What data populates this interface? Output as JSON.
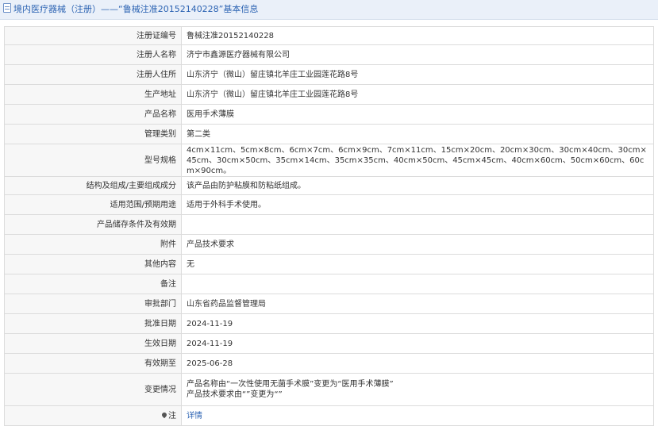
{
  "header": {
    "breadcrumb_root": "境内医疗器械（注册）",
    "separator": "——",
    "page_title": "“鲁械注准20152140228”基本信息"
  },
  "rows": [
    {
      "label": "注册证编号",
      "value": "鲁械注准20152140228"
    },
    {
      "label": "注册人名称",
      "value": "济宁市鑫源医疗器械有限公司"
    },
    {
      "label": "注册人住所",
      "value": "山东济宁（微山）留庄镇北羊庄工业园莲花路8号"
    },
    {
      "label": "生产地址",
      "value": "山东济宁（微山）留庄镇北羊庄工业园莲花路8号"
    },
    {
      "label": "产品名称",
      "value": "医用手术薄膜"
    },
    {
      "label": "管理类别",
      "value": "第二类"
    },
    {
      "label": "型号规格",
      "value": "4cm×11cm、5cm×8cm、6cm×7cm、6cm×9cm、7cm×11cm、15cm×20cm、20cm×30cm、30cm×40cm、30cm×45cm、30cm×50cm、35cm×14cm、35cm×35cm、40cm×50cm、45cm×45cm、40cm×60cm、50cm×60cm、60cm×90cm。"
    },
    {
      "label": "结构及组成/主要组成成分",
      "value": "该产品由防护粘膜和防粘纸组成。"
    },
    {
      "label": "适用范围/预期用途",
      "value": "适用于外科手术使用。"
    },
    {
      "label": "产品储存条件及有效期",
      "value": ""
    },
    {
      "label": "附件",
      "value": "产品技术要求"
    },
    {
      "label": "其他内容",
      "value": "无"
    },
    {
      "label": "备注",
      "value": ""
    },
    {
      "label": "审批部门",
      "value": "山东省药品监督管理局"
    },
    {
      "label": "批准日期",
      "value": "2024-11-19"
    },
    {
      "label": "生效日期",
      "value": "2024-11-19"
    },
    {
      "label": "有效期至",
      "value": "2025-06-28"
    }
  ],
  "change_record": {
    "label": "变更情况",
    "line1": "产品名称由“一次性使用无菌手术膜”变更为“医用手术薄膜”",
    "line2": "产品技术要求由“”变更为“”"
  },
  "detail_row": {
    "label": "注",
    "link_text": "详情"
  }
}
